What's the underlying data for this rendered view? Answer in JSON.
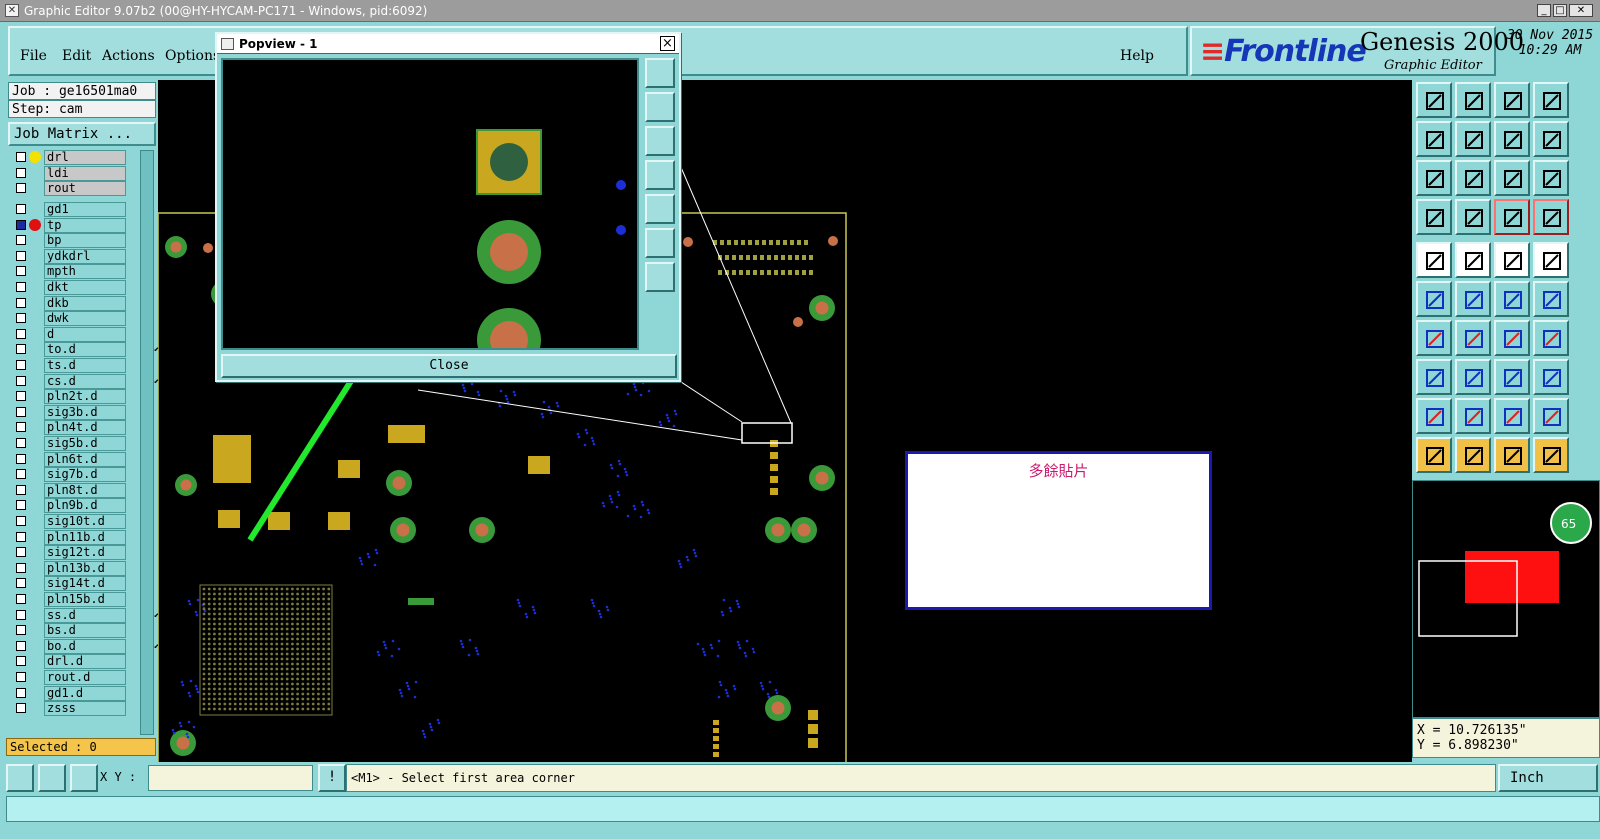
{
  "window": {
    "title": "Graphic Editor 9.07b2 (00@HY-HYCAM-PC171 - Windows, pid:6092)"
  },
  "menu": {
    "file": "File",
    "edit": "Edit",
    "actions": "Actions",
    "options": "Options",
    "help": "Help"
  },
  "brand": {
    "logo": "Frontline",
    "product": "Genesis 2000",
    "subtitle": "Graphic Editor",
    "date": "30 Nov 2015",
    "time": "10:29 AM"
  },
  "job": {
    "job_label": "Job : ge16501ma0",
    "step_label": "Step: cam",
    "matrix_button": "Job Matrix ..."
  },
  "layers": [
    {
      "name": "drl",
      "gray": true,
      "dot": "#f5e000"
    },
    {
      "name": "ldi",
      "gray": true
    },
    {
      "name": "rout",
      "gray": true
    },
    {
      "name": "gd1"
    },
    {
      "name": "tp",
      "dot": "#e01010",
      "checked": true
    },
    {
      "name": "bp"
    },
    {
      "name": "ydkdrl"
    },
    {
      "name": "mpth"
    },
    {
      "name": "dkt"
    },
    {
      "name": "dkb"
    },
    {
      "name": "dwk"
    },
    {
      "name": "d"
    },
    {
      "name": "to.d",
      "mark": true
    },
    {
      "name": "ts.d"
    },
    {
      "name": "cs.d",
      "mark": true
    },
    {
      "name": "pln2t.d"
    },
    {
      "name": "sig3b.d"
    },
    {
      "name": "pln4t.d"
    },
    {
      "name": "sig5b.d"
    },
    {
      "name": "pln6t.d"
    },
    {
      "name": "sig7b.d"
    },
    {
      "name": "pln8t.d"
    },
    {
      "name": "pln9b.d"
    },
    {
      "name": "sig10t.d"
    },
    {
      "name": "pln11b.d"
    },
    {
      "name": "sig12t.d"
    },
    {
      "name": "pln13b.d"
    },
    {
      "name": "sig14t.d"
    },
    {
      "name": "pln15b.d"
    },
    {
      "name": "ss.d",
      "mark": true
    },
    {
      "name": "bs.d"
    },
    {
      "name": "bo.d",
      "mark": true
    },
    {
      "name": "drl.d"
    },
    {
      "name": "rout.d"
    },
    {
      "name": "gd1.d"
    },
    {
      "name": "zsss"
    }
  ],
  "selected": "Selected : 0",
  "popview": {
    "title": "Popview - 1",
    "close_button": "Close"
  },
  "note": {
    "text": "多餘貼片"
  },
  "coords": {
    "x": "X = 10.726135\"",
    "y": "Y = 6.898230\""
  },
  "bottom": {
    "xy_label": "X Y :",
    "prompt": "<M1> - Select first area corner",
    "units": "Inch"
  },
  "minimap_badge": "65"
}
